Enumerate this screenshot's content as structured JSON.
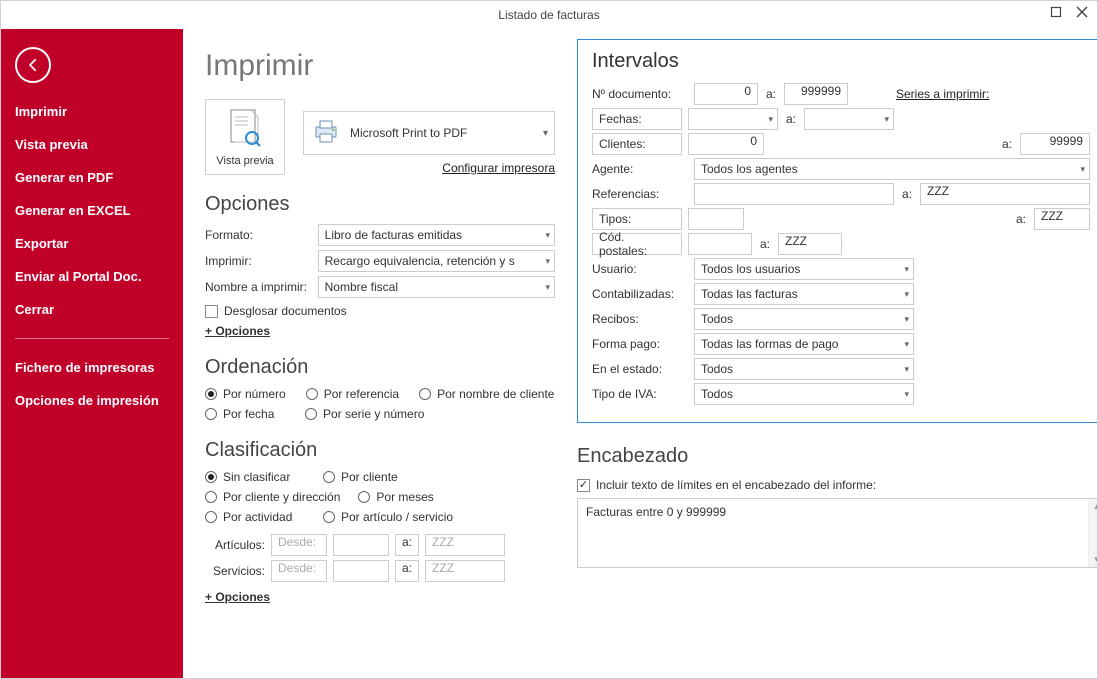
{
  "window": {
    "title": "Listado de facturas"
  },
  "sidebar": {
    "items": [
      "Imprimir",
      "Vista previa",
      "Generar en PDF",
      "Generar en EXCEL",
      "Exportar",
      "Enviar al Portal Doc.",
      "Cerrar"
    ],
    "secondary": [
      "Fichero de impresoras",
      "Opciones de impresión"
    ]
  },
  "page": {
    "heading": "Imprimir",
    "preview_label": "Vista previa",
    "printer": "Microsoft Print to PDF",
    "config_link": "Configurar impresora"
  },
  "opciones": {
    "heading": "Opciones",
    "formato_label": "Formato:",
    "formato_value": "Libro de facturas emitidas",
    "imprimir_label": "Imprimir:",
    "imprimir_value": "Recargo equivalencia, retención y s",
    "nombre_label": "Nombre a imprimir:",
    "nombre_value": "Nombre fiscal",
    "desglosar": "Desglosar documentos",
    "more": "+ Opciones"
  },
  "ordenacion": {
    "heading": "Ordenación",
    "options": [
      "Por número",
      "Por referencia",
      "Por nombre de cliente",
      "Por fecha",
      "Por serie y número"
    ],
    "selected": 0
  },
  "clasificacion": {
    "heading": "Clasificación",
    "options": [
      "Sin clasificar",
      "Por cliente",
      "Por cliente y dirección",
      "Por meses",
      "Por actividad",
      "Por artículo / servicio"
    ],
    "selected": 0,
    "articulos_label": "Artículos:",
    "servicios_label": "Servicios:",
    "desde_ph": "Desde:",
    "a_label": "a:",
    "zzz_ph": "ZZZ",
    "more": "+ Opciones"
  },
  "intervalos": {
    "heading": "Intervalos",
    "ndoc_label": "Nº documento:",
    "ndoc_from": "0",
    "ndoc_to": "999999",
    "a_label": "a:",
    "series_link": "Series a imprimir:",
    "fechas_label": "Fechas:",
    "clientes_label": "Clientes:",
    "clientes_from": "0",
    "clientes_to": "99999",
    "agente_label": "Agente:",
    "agente_value": "Todos los agentes",
    "referencias_label": "Referencias:",
    "ref_to_ph": "ZZZ",
    "tipos_label": "Tipos:",
    "tipos_to_ph": "ZZZ",
    "codpostales_label": "Cód. postales:",
    "codpostales_to_ph": "ZZZ",
    "usuario_label": "Usuario:",
    "usuario_value": "Todos los usuarios",
    "contab_label": "Contabilizadas:",
    "contab_value": "Todas las facturas",
    "recibos_label": "Recibos:",
    "recibos_value": "Todos",
    "fpago_label": "Forma pago:",
    "fpago_value": "Todas las formas de pago",
    "estado_label": "En el estado:",
    "estado_value": "Todos",
    "iva_label": "Tipo de IVA:",
    "iva_value": "Todos"
  },
  "encabezado": {
    "heading": "Encabezado",
    "check_label": "Incluir texto de límites en el encabezado del informe:",
    "text": "Facturas entre 0 y 999999"
  }
}
